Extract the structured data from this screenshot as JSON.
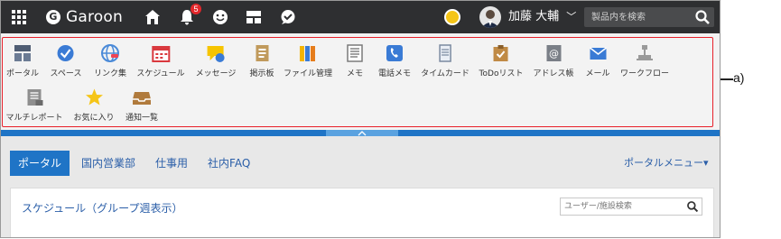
{
  "header": {
    "app_name": "Garoon",
    "notification_count": "5",
    "user_name": "加藤 大輔",
    "search_placeholder": "製品内を検索"
  },
  "app_menu": {
    "row1": [
      {
        "label": "ポータル",
        "icon": "portal-icon"
      },
      {
        "label": "スペース",
        "icon": "space-icon"
      },
      {
        "label": "リンク集",
        "icon": "link-icon"
      },
      {
        "label": "スケジュール",
        "icon": "schedule-icon"
      },
      {
        "label": "メッセージ",
        "icon": "message-icon"
      },
      {
        "label": "掲示板",
        "icon": "bulletin-icon"
      },
      {
        "label": "ファイル管理",
        "icon": "file-icon"
      },
      {
        "label": "メモ",
        "icon": "memo-icon"
      },
      {
        "label": "電話メモ",
        "icon": "phone-icon"
      },
      {
        "label": "タイムカード",
        "icon": "timecard-icon"
      },
      {
        "label": "ToDoリスト",
        "icon": "todo-icon"
      },
      {
        "label": "アドレス帳",
        "icon": "address-icon"
      },
      {
        "label": "メール",
        "icon": "mail-icon"
      },
      {
        "label": "ワークフロー",
        "icon": "workflow-icon"
      }
    ],
    "row2": [
      {
        "label": "マルチレポート",
        "icon": "report-icon"
      },
      {
        "label": "お気に入り",
        "icon": "star-icon"
      },
      {
        "label": "通知一覧",
        "icon": "inbox-icon"
      }
    ]
  },
  "portal": {
    "tabs": [
      "ポータル",
      "国内営業部",
      "仕事用",
      "社内FAQ"
    ],
    "portal_menu": "ポータルメニュー▾",
    "panel_title": "スケジュール（グループ週表示）",
    "user_search_placeholder": "ユーザー/施設検索"
  },
  "annotation": {
    "label": "a)"
  },
  "colors": {
    "header": "#2e2f31",
    "accent": "#1f74c6",
    "highlight": "#e8202a"
  }
}
